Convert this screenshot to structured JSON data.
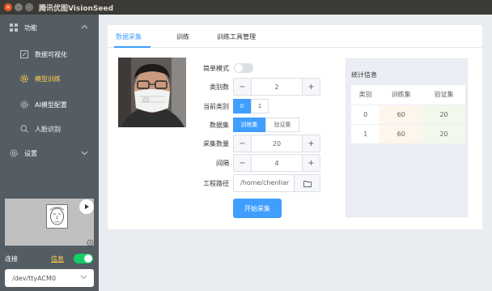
{
  "window": {
    "title": "腾讯优图VisionSeed"
  },
  "sidebar": {
    "groups": [
      {
        "label": "功能"
      },
      {
        "label": "设置"
      }
    ],
    "items": [
      {
        "label": "数据可视化"
      },
      {
        "label": "模型训练"
      },
      {
        "label": "AI模型配置"
      },
      {
        "label": "人脸识别"
      }
    ],
    "connection": {
      "label": "连接",
      "link": "信息",
      "connected": true
    },
    "port": {
      "value": "/dev/ttyACM0"
    }
  },
  "tabs": [
    {
      "label": "数据采集"
    },
    {
      "label": "训练"
    },
    {
      "label": "训练工具管理"
    }
  ],
  "form": {
    "simple_mode_label": "简单模式",
    "simple_mode": false,
    "class_count_label": "类别数",
    "class_count": "2",
    "current_class_label": "当前类别",
    "current_class_options": [
      "0",
      "1"
    ],
    "current_class_selected": "0",
    "dataset_label": "数据集",
    "dataset_options": [
      "训练集",
      "验证集"
    ],
    "dataset_selected": "训练集",
    "sample_count_label": "采集数量",
    "sample_count": "20",
    "interval_label": "间隔",
    "interval": "4",
    "path_label": "工程路径",
    "path_value": "/home/chenliar",
    "start_button": "开始采集"
  },
  "stats": {
    "title": "统计信息",
    "headers": [
      "类别",
      "训练集",
      "验证集"
    ],
    "rows": [
      [
        "0",
        "60",
        "20"
      ],
      [
        "1",
        "60",
        "20"
      ]
    ]
  },
  "colors": {
    "accent": "#409eff",
    "active_menu": "#ffd04b",
    "sidebar_bg": "#545c64",
    "toggle_on": "#13ce66"
  }
}
